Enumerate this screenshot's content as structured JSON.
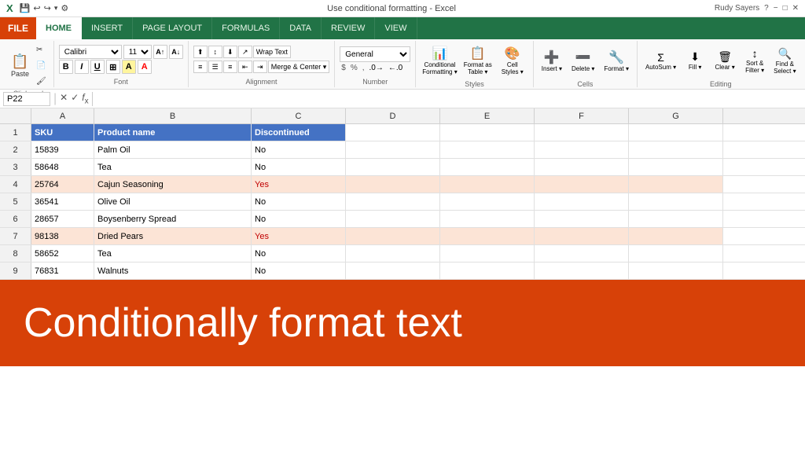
{
  "titleBar": {
    "title": "Use conditional formatting - Excel",
    "leftIcons": [
      "💾",
      "↩",
      "↪",
      "▾"
    ],
    "rightUser": "Rudy Sayers",
    "windowBtns": [
      "?",
      "−",
      "□",
      "✕"
    ]
  },
  "ribbon": {
    "tabs": [
      "FILE",
      "HOME",
      "INSERT",
      "PAGE LAYOUT",
      "FORMULAS",
      "DATA",
      "REVIEW",
      "VIEW"
    ],
    "activeTab": "HOME",
    "groups": {
      "clipboard": {
        "label": "Clipboard"
      },
      "font": {
        "label": "Font",
        "fontName": "Calibri",
        "fontSize": "11"
      },
      "alignment": {
        "label": "Alignment"
      },
      "number": {
        "label": "Number",
        "format": "General"
      },
      "styles": {
        "label": "Styles"
      },
      "cells": {
        "label": "Cells"
      },
      "editing": {
        "label": "Editing"
      }
    },
    "buttons": {
      "paste": "Paste",
      "conditionalFormatting": "Conditional\nFormatting",
      "formatAsTable": "Format as\nTable",
      "cellStyles": "Cell\nStyles",
      "insert": "Insert",
      "delete": "Delete",
      "format": "Format",
      "autosum": "AutoSum",
      "fill": "Fill",
      "clear": "Clear",
      "sortFilter": "Sort &\nFilter",
      "findSelect": "Find &\nSelect",
      "wrapText": "Wrap Text",
      "mergeCenter": "Merge & Center"
    }
  },
  "formulaBar": {
    "nameBox": "P22",
    "formula": ""
  },
  "columns": {
    "headers": [
      "A",
      "B",
      "C",
      "D",
      "E",
      "F",
      "G"
    ]
  },
  "spreadsheet": {
    "headerRow": {
      "sku": "SKU",
      "productName": "Product name",
      "discontinued": "Discontinued"
    },
    "rows": [
      {
        "rowNum": "2",
        "sku": "15839",
        "product": "Palm Oil",
        "discontinued": "No",
        "highlight": false
      },
      {
        "rowNum": "3",
        "sku": "58648",
        "product": "Tea",
        "discontinued": "No",
        "highlight": false
      },
      {
        "rowNum": "4",
        "sku": "25764",
        "product": "Cajun Seasoning",
        "discontinued": "Yes",
        "highlight": true
      },
      {
        "rowNum": "5",
        "sku": "36541",
        "product": "Olive Oil",
        "discontinued": "No",
        "highlight": false
      },
      {
        "rowNum": "6",
        "sku": "28657",
        "product": "Boysenberry Spread",
        "discontinued": "No",
        "highlight": false
      },
      {
        "rowNum": "7",
        "sku": "98138",
        "product": "Dried Pears",
        "discontinued": "Yes",
        "highlight": true
      },
      {
        "rowNum": "8",
        "sku": "58652",
        "product": "Tea",
        "discontinued": "No",
        "highlight": false
      },
      {
        "rowNum": "9",
        "sku": "76831",
        "product": "Walnuts",
        "discontinued": "No",
        "highlight": false
      }
    ]
  },
  "banner": {
    "text": "Conditionally format text"
  }
}
